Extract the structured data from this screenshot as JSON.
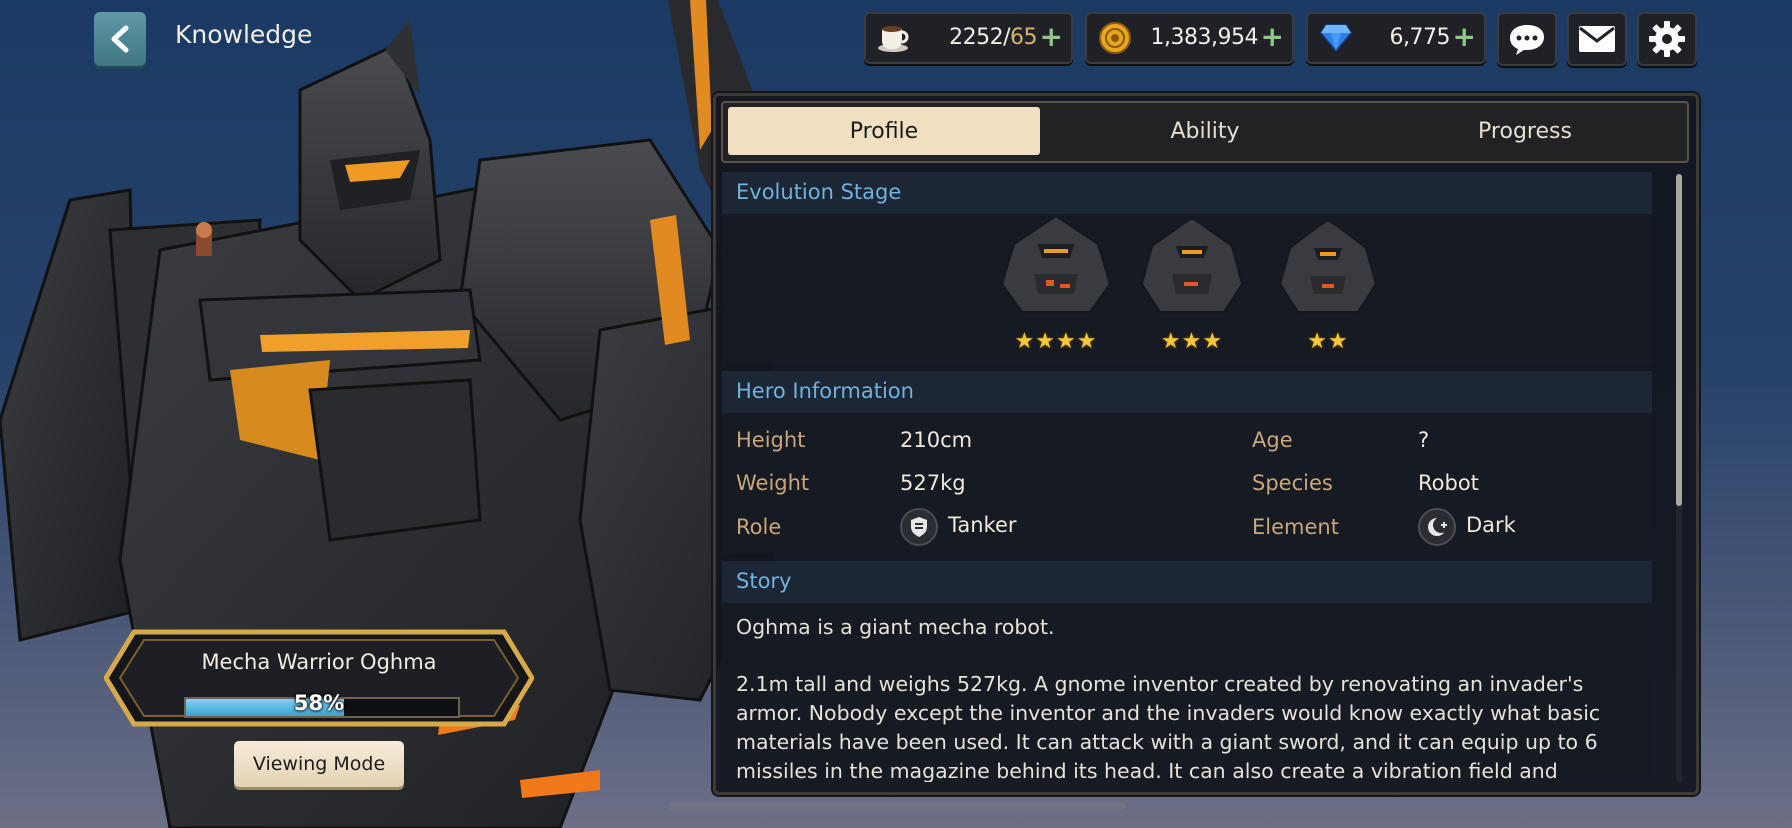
{
  "header": {
    "title": "Knowledge"
  },
  "resources": [
    {
      "name": "stamina",
      "icon": "coffee-cup-icon",
      "current": "2252",
      "separator": "/",
      "max": "65"
    },
    {
      "name": "gold",
      "icon": "gold-coin-icon",
      "value": "1,383,954"
    },
    {
      "name": "gems",
      "icon": "diamond-icon",
      "value": "6,775"
    }
  ],
  "tabs": [
    {
      "label": "Profile",
      "active": true
    },
    {
      "label": "Ability",
      "active": false
    },
    {
      "label": "Progress",
      "active": false
    }
  ],
  "evolution": {
    "heading": "Evolution Stage",
    "stages": [
      {
        "stars": "★★★★"
      },
      {
        "stars": "★★★"
      },
      {
        "stars": "★★"
      }
    ]
  },
  "hero_info": {
    "heading": "Hero Information",
    "height_label": "Height",
    "height_value": "210cm",
    "weight_label": "Weight",
    "weight_value": "527kg",
    "role_label": "Role",
    "role_value": "Tanker",
    "age_label": "Age",
    "age_value": "?",
    "species_label": "Species",
    "species_value": "Robot",
    "element_label": "Element",
    "element_value": "Dark"
  },
  "story": {
    "heading": "Story",
    "paragraphs": [
      "Oghma is a giant mecha robot.",
      "2.1m tall and weighs 527kg. A gnome inventor created by renovating an invader's armor. Nobody except the inventor and the invaders would know exactly what basic materials have been used. It can attack with a giant sword, and it can equip up to 6 missiles in the magazine behind its head. It can also create a vibration field and convey"
    ]
  },
  "hero": {
    "name": "Mecha Warrior Oghma",
    "progress_percent": 58,
    "progress_label": "58%"
  },
  "viewing_mode_label": "Viewing Mode",
  "colors": {
    "accent_blue": "#6fb2dc",
    "tab_active": "#f1dfc2",
    "label_gold": "#c9a77a",
    "star": "#f4c63b"
  }
}
